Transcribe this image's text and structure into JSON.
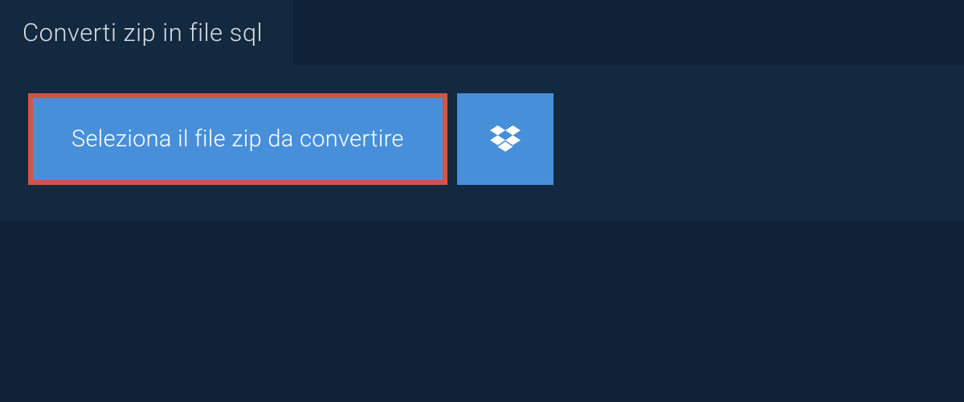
{
  "tab": {
    "label": "Converti zip in file sql"
  },
  "buttons": {
    "select_file_label": "Seleziona il file zip da convertire"
  },
  "colors": {
    "background": "#0f2238",
    "panel": "#13293f",
    "button": "#4790d9",
    "highlight_border": "#cf5548",
    "text_light": "#d8dde2",
    "text_white": "#ffffff"
  }
}
